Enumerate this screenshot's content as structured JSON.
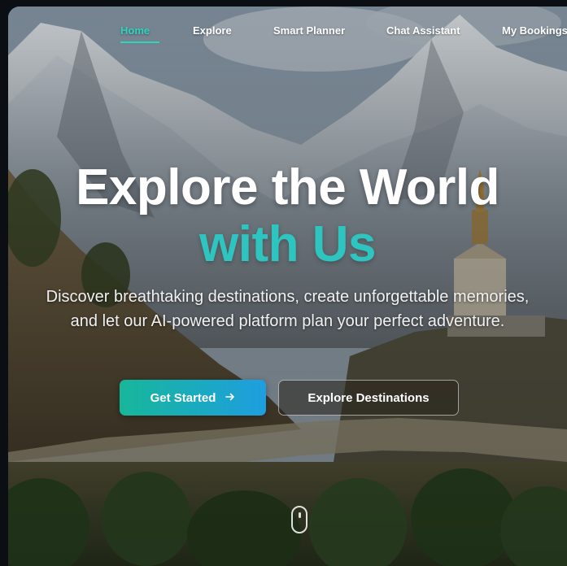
{
  "nav": {
    "items": [
      {
        "label": "Home",
        "active": true
      },
      {
        "label": "Explore",
        "active": false
      },
      {
        "label": "Smart Planner",
        "active": false
      },
      {
        "label": "Chat Assistant",
        "active": false
      },
      {
        "label": "My Bookings",
        "active": false
      }
    ]
  },
  "hero": {
    "title": "Explore the World",
    "title_accent": "with Us",
    "subtitle": "Discover breathtaking destinations, create unforgettable memories, and let our AI-powered platform plan your perfect adventure."
  },
  "buttons": {
    "primary_label": "Get Started",
    "primary_icon": "arrow-right-icon",
    "secondary_label": "Explore Destinations"
  },
  "colors": {
    "accent": "#2dd4bf",
    "title_accent": "#2ec4c0",
    "button_gradient_start": "#17b79a",
    "button_gradient_end": "#1e9ee0"
  }
}
